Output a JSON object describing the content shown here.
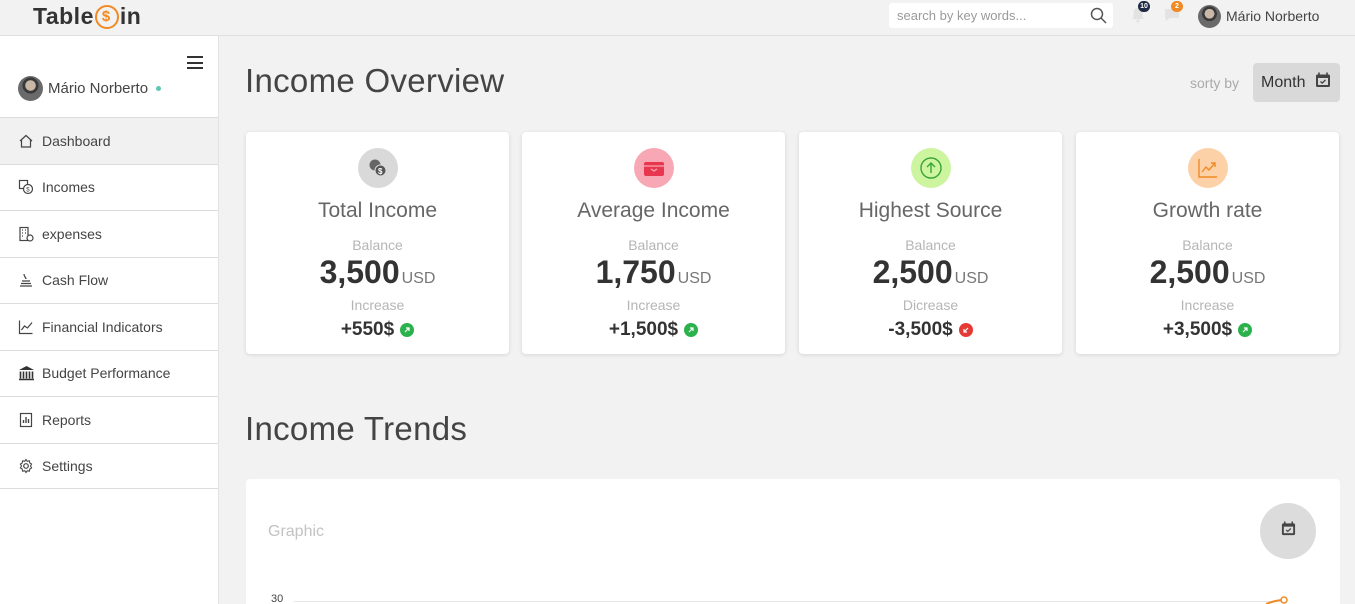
{
  "app": {
    "logo_text_left": "Table",
    "logo_text_right": "in"
  },
  "topbar": {
    "search_placeholder": "search by key words...",
    "notifications_count": "10",
    "messages_count": "2",
    "user_name": "Mário Norberto",
    "colors": {
      "notif_badge": "#1f2a44",
      "msg_badge": "#f08a24"
    }
  },
  "sidebar": {
    "user_name": "Mário Norberto",
    "items": [
      {
        "label": "Dashboard",
        "icon": "home-icon"
      },
      {
        "label": "Incomes",
        "icon": "incomes-icon"
      },
      {
        "label": "expenses",
        "icon": "expenses-icon"
      },
      {
        "label": "Cash Flow",
        "icon": "cash-flow-icon"
      },
      {
        "label": "Financial Indicators",
        "icon": "chart-line-icon"
      },
      {
        "label": "Budget Performance",
        "icon": "bank-icon"
      },
      {
        "label": "Reports",
        "icon": "reports-icon"
      },
      {
        "label": "Settings",
        "icon": "gear-icon"
      }
    ],
    "active_item": "Dashboard"
  },
  "overview": {
    "title": "Income Overview",
    "sort_label": "sorty by",
    "sort_value": "Month",
    "cards": [
      {
        "title": "Total Income",
        "balance_label": "Balance",
        "amount": "3,500",
        "currency": "USD",
        "change_label": "Increase",
        "change": "+550$",
        "direction": "up",
        "icon": "coins-icon",
        "icon_bg": "#d9d9d9",
        "icon_color": "#555555"
      },
      {
        "title": "Average Income",
        "balance_label": "Balance",
        "amount": "1,750",
        "currency": "USD",
        "change_label": "Increase",
        "change": "+1,500$",
        "direction": "up",
        "icon": "wallet-icon",
        "icon_bg": "#f7a8b4",
        "icon_color": "#e8364f"
      },
      {
        "title": "Highest Source",
        "balance_label": "Balance",
        "amount": "2,500",
        "currency": "USD",
        "change_label": "Dicrease",
        "change": "-3,500$",
        "direction": "down",
        "icon": "arrow-up-circle-icon",
        "icon_bg": "#cdf5a0",
        "icon_color": "#3aa33a"
      },
      {
        "title": "Growth rate",
        "balance_label": "Balance",
        "amount": "2,500",
        "currency": "USD",
        "change_label": "Increase",
        "change": "+3,500$",
        "direction": "up",
        "icon": "trend-icon",
        "icon_bg": "#fdd1a8",
        "icon_color": "#f08a24"
      }
    ],
    "colors": {
      "up": "#2bb24c",
      "down": "#e53935"
    }
  },
  "trends": {
    "title": "Income Trends",
    "graphic_label": "Graphic",
    "y_tick_top": "30",
    "line_color": "#f08a24"
  }
}
